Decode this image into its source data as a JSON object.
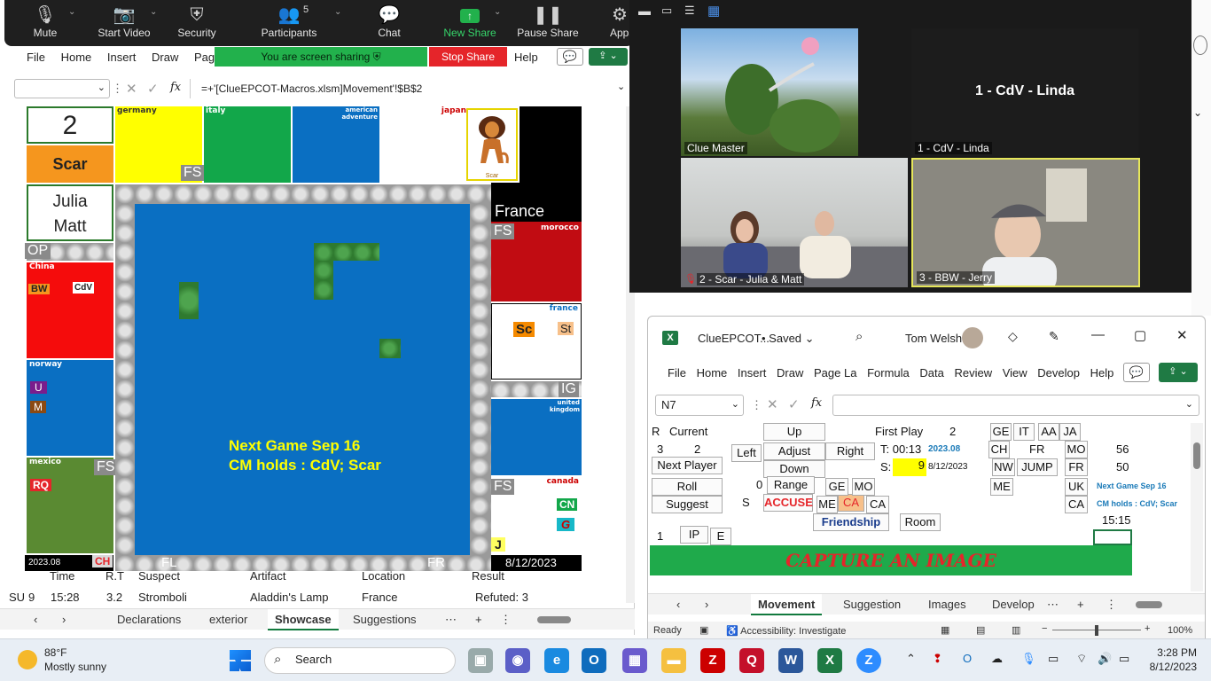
{
  "zoom": {
    "buttons": [
      {
        "label": "Mute",
        "icon": "mic-icon"
      },
      {
        "label": "Start Video",
        "icon": "video-off-icon"
      },
      {
        "label": "Security",
        "icon": "shield-icon"
      },
      {
        "label": "Participants",
        "icon": "participants-icon",
        "count": "5"
      },
      {
        "label": "Chat",
        "icon": "chat-icon"
      },
      {
        "label": "New Share",
        "icon": "share-up-icon"
      },
      {
        "label": "Pause Share",
        "icon": "pause-icon"
      },
      {
        "label": "Apps",
        "icon": "apps-icon"
      }
    ],
    "sharing_text": "You are screen sharing",
    "stop_share": "Stop Share",
    "videos": [
      {
        "name": "Clue Master"
      },
      {
        "name": "1 - CdV - Linda",
        "center_label": "1 - CdV - Linda"
      },
      {
        "name": "2 - Scar - Julia & Matt"
      },
      {
        "name": "3 - BBW - Jerry"
      }
    ]
  },
  "left_excel": {
    "menu": [
      "File",
      "Home",
      "Insert",
      "Draw",
      "Page",
      "Help"
    ],
    "formula": "=+'[ClueEPCOT-Macros.xlsm]Movement'!$B$2",
    "fx": "fx",
    "board": {
      "turn_number": "2",
      "current_suspect": "Scar",
      "players_line1": "Julia",
      "players_line2": "Matt",
      "countries": {
        "germany": "germany",
        "italy": "italy",
        "american": "american adventure",
        "japan": "japan",
        "china": "China",
        "norway": "norway",
        "mexico": "mexico",
        "morocco": "morocco",
        "france": "france",
        "uk": "united kingdom",
        "canada": "canada",
        "France_big": "France"
      },
      "markers": {
        "fs1": "FS",
        "fs2": "FS",
        "fs3": "FS",
        "fs4": "FS",
        "op": "OP",
        "ig": "IG",
        "fl": "FL",
        "fr": "FR",
        "ch": "CH",
        "bw": "BW",
        "cdv": "CdV",
        "u": "U",
        "m": "M",
        "rq": "RQ",
        "sc": "Sc",
        "st": "St",
        "cn": "CN",
        "g": "G",
        "j": "J",
        "scar_caption": "Scar"
      },
      "version": "2023.08",
      "date": "8/12/2023",
      "next_game": "Next Game Sep 16",
      "cm_holds": "CM holds : CdV; Scar"
    },
    "table_header": [
      "Time",
      "R.T",
      "Suspect",
      "Artifact",
      "Location",
      "Result"
    ],
    "table_row": {
      "su": "SU",
      "num": "9",
      "time": "15:28",
      "rt": "3.2",
      "suspect": "Stromboli",
      "artifact": "Aladdin's Lamp",
      "location": "France",
      "result": "Refuted: 3"
    },
    "tabs": [
      "Declarations",
      "exterior",
      "Showcase",
      "Suggestions"
    ],
    "active_tab": "Showcase"
  },
  "right_excel": {
    "title": "ClueEPCOT...",
    "saved": "Saved",
    "user": "Tom Welsh",
    "menu": [
      "File",
      "Home",
      "Insert",
      "Draw",
      "Page La",
      "Formula",
      "Data",
      "Review",
      "View",
      "Develop",
      "Help"
    ],
    "namebox": "N7",
    "cells": {
      "r": "R",
      "current": "Current",
      "three": "3",
      "two": "2",
      "up": "Up",
      "left": "Left",
      "adjust": "Adjust",
      "right": "Right",
      "down": "Down",
      "next_player": "Next Player",
      "roll": "Roll",
      "zero": "0",
      "range": "Range",
      "suggest": "Suggest",
      "s": "S",
      "accuse": "ACCUSE",
      "me": "ME",
      "ca": "CA",
      "ca2": "CA",
      "friendship": "Friendship",
      "room": "Room",
      "ge": "GE",
      "mo": "MO",
      "first_play": "First Play",
      "first_play_val": "2",
      "t_label": "T: 00:13",
      "version": "2023.08",
      "s_label": "S:",
      "s_val": "9",
      "date": "8/12/2023",
      "ge2": "GE",
      "it": "IT",
      "aa": "AA",
      "ja": "JA",
      "ch": "CH",
      "fr": "FR",
      "mo2": "MO",
      "v56": "56",
      "nw": "NW",
      "jump": "JUMP",
      "fr2": "FR",
      "v50": "50",
      "me2": "ME",
      "uk": "UK",
      "ca3": "CA",
      "next_game": "Next Game Sep 16",
      "cm_holds": "CM holds : CdV; Scar",
      "time": "15:15",
      "one": "1",
      "ip": "IP",
      "e": "E",
      "capture": "CAPTURE AN IMAGE"
    },
    "tabs": [
      "Movement",
      "Suggestion",
      "Images",
      "Develop"
    ],
    "active_tab": "Movement",
    "status": {
      "ready": "Ready",
      "accessibility": "Accessibility: Investigate",
      "zoom": "100%"
    }
  },
  "taskbar": {
    "weather_temp": "88°F",
    "weather_desc": "Mostly sunny",
    "search": "Search",
    "time": "3:28 PM",
    "date": "8/12/2023"
  },
  "colors": {
    "excel_green": "#1f7a44",
    "board_blue": "#0a6fc2",
    "capture_green": "#1faa4b"
  }
}
